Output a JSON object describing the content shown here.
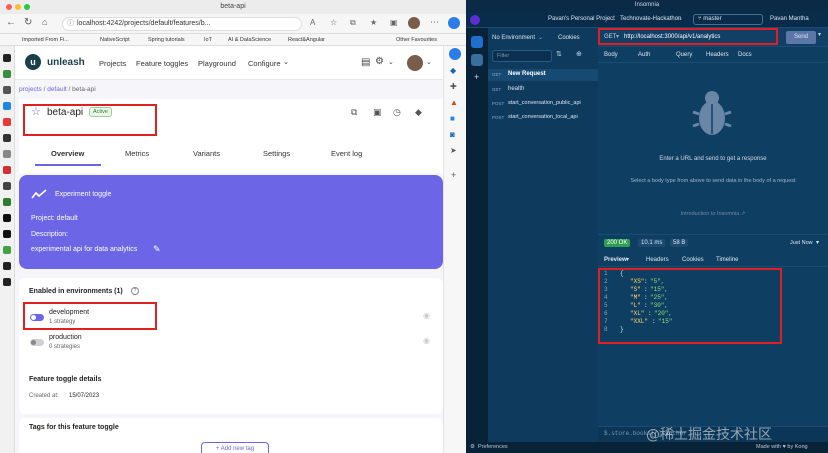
{
  "left_browser": {
    "window_title": "beta-api",
    "url": "localhost:4242/projects/default/features/b...",
    "bookmarks": [
      "Imported From Fi...",
      "NativeScript",
      "Spring tutorials",
      "IoT",
      "AI & DataScience",
      "React&Angular",
      "Other Favourites"
    ],
    "nav": {
      "brand": "unleash",
      "links": [
        "Projects",
        "Feature toggles",
        "Playground",
        "Configure"
      ]
    },
    "breadcrumb": {
      "projects": "projects",
      "sep1": "/",
      "default": "default",
      "sep2": "/",
      "current": "beta-api"
    },
    "feature": {
      "name": "beta-api",
      "status_badge": "Active"
    },
    "tabs": [
      "Overview",
      "Metrics",
      "Variants",
      "Settings",
      "Event log"
    ],
    "overview": {
      "type_label": "Experiment toggle",
      "project": "Project: default",
      "description_label": "Description:",
      "description": "experimental api for data analytics"
    },
    "environments": {
      "title": "Enabled in environments (1)",
      "items": [
        {
          "name": "development",
          "strategies": "1 strategy",
          "enabled": true
        },
        {
          "name": "production",
          "strategies": "0 strategies",
          "enabled": false
        }
      ]
    },
    "details": {
      "title": "Feature toggle details",
      "created_label": "Created at:",
      "created_value": "15/07/2023"
    },
    "tags": {
      "title": "Tags for this feature toggle",
      "add_label": "+ Add new tag"
    }
  },
  "insomnia": {
    "window_title": "Insomnia",
    "workspace": "Pavan's Personal Project",
    "project": "Technovate-Hackathon",
    "branch": "master",
    "user": "Pavan Mantha",
    "environment": "No Environment",
    "cookies": "Cookies",
    "filter_placeholder": "Filter",
    "requests": [
      {
        "method": "GET",
        "name": "New Request"
      },
      {
        "method": "GET",
        "name": "health"
      },
      {
        "method": "POST",
        "name": "start_conversation_public_api"
      },
      {
        "method": "POST",
        "name": "start_conversation_local_api"
      }
    ],
    "request": {
      "method": "GET",
      "url": "http://localhost:3000/api/v1/analytics",
      "send_label": "Send"
    },
    "request_tabs": [
      "Body",
      "Auth",
      "Query",
      "Headers",
      "Docs"
    ],
    "empty_title": "Enter a URL and send to get a response",
    "empty_sub": "Select a body type from above to send data in the body of a request",
    "intro_link": "Introduction to Insomnia",
    "response": {
      "status": "200 OK",
      "time": "10.1 ms",
      "size": "58 B",
      "when": "Just Now"
    },
    "response_tabs": [
      "Preview",
      "Headers",
      "Cookies",
      "Timeline"
    ],
    "json_lines": [
      {
        "n": "1",
        "t": "{"
      },
      {
        "n": "2",
        "k": "\"XS\"",
        "v": "\"5\","
      },
      {
        "n": "3",
        "k": "\"S\"",
        "v": "\"15\","
      },
      {
        "n": "4",
        "k": "\"M\"",
        "v": "\"25\","
      },
      {
        "n": "5",
        "k": "\"L\"",
        "v": "\"30\","
      },
      {
        "n": "6",
        "k": "\"XL\"",
        "v": "\"20\","
      },
      {
        "n": "7",
        "k": "\"XXL\"",
        "v": "\"15\""
      },
      {
        "n": "8",
        "t": "}"
      }
    ],
    "filter_expr": "$.store.books[*].author",
    "status_left": "Preferences",
    "status_right": "Made with ♥ by Kong"
  },
  "watermark": "@稀土掘金技术社区",
  "colors": {
    "unleash_purple": "#6c65e5",
    "insomnia_bg": "#0d3455",
    "annotation_red": "#e02020"
  }
}
